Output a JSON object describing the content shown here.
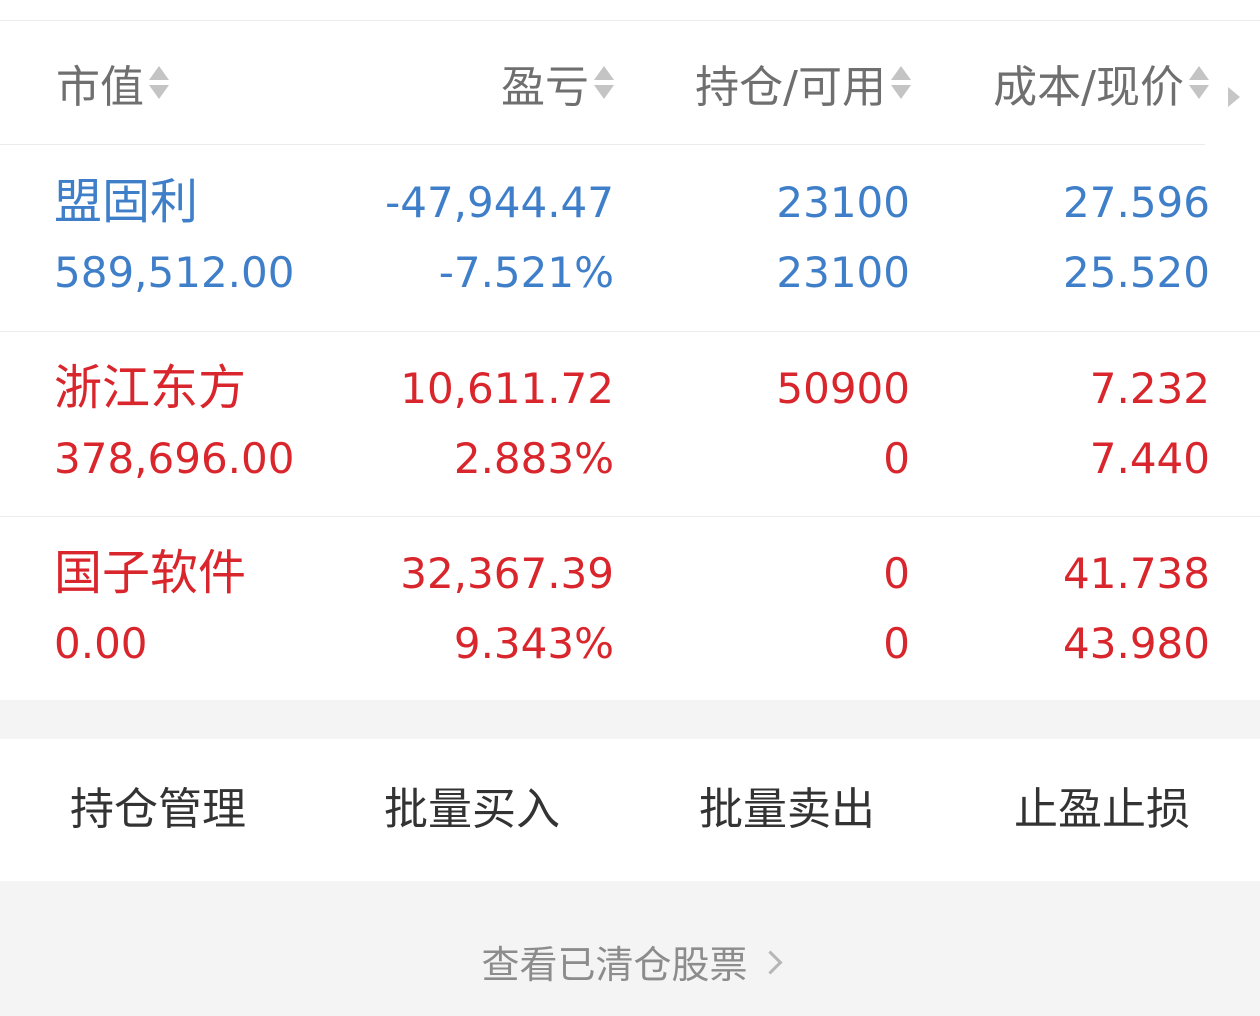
{
  "header": {
    "col1": "市值",
    "col2": "盈亏",
    "col3": "持仓/可用",
    "col4": "成本/现价"
  },
  "holdings": [
    {
      "name": "盟固利",
      "market_value": "589,512.00",
      "pnl": "-47,944.47",
      "pnl_pct": "-7.521%",
      "position": "23100",
      "available": "23100",
      "cost": "27.596",
      "price": "25.520",
      "color": "#3f7fc9"
    },
    {
      "name": "浙江东方",
      "market_value": "378,696.00",
      "pnl": "10,611.72",
      "pnl_pct": "2.883%",
      "position": "50900",
      "available": "0",
      "cost": "7.232",
      "price": "7.440",
      "color": "#d9262c"
    },
    {
      "name": "国子软件",
      "market_value": "0.00",
      "pnl": "32,367.39",
      "pnl_pct": "9.343%",
      "position": "0",
      "available": "0",
      "cost": "41.738",
      "price": "43.980",
      "color": "#d9262c"
    }
  ],
  "actions": {
    "manage": "持仓管理",
    "batch_buy": "批量买入",
    "batch_sell": "批量卖出",
    "stop": "止盈止损"
  },
  "footer": {
    "cleared_link": "查看已清仓股票"
  }
}
